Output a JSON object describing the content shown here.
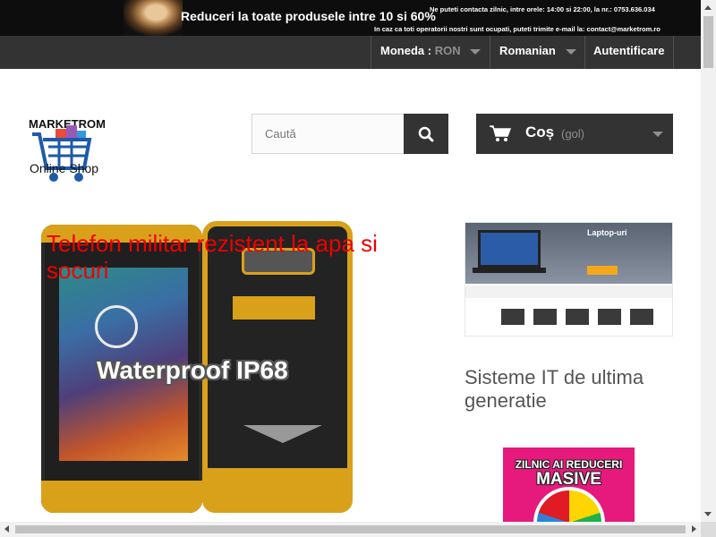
{
  "promo_banner": {
    "title": "Reduceri la toate produsele intre 10 si 60%",
    "contact": "Ne puteti contacta zilnic, intre orele: 14:00 si 22:00, la nr.: 0753.636.034",
    "fallback": "In caz ca toti operatorii nostri sunt ocupati, puteti trimite e-mail la: contact@marketrom.ro"
  },
  "nav": {
    "currency_label": "Moneda :",
    "currency_value": "RON",
    "language": "Romanian",
    "login": "Autentificare"
  },
  "header": {
    "logo_text": "MARKETROM",
    "logo_sub": "Online Shop",
    "search_placeholder": "Caută",
    "cart_label": "Coș",
    "cart_state": "(gol)"
  },
  "slider": {
    "title": "Telefon militar rezistent la apa si socuri",
    "image_text": "Waterproof IP68"
  },
  "sidebar": {
    "banner_title": "Laptop-uri",
    "heading": "Sisteme IT de ultima generatie",
    "promo_line1": "ZILNIC AI REDUCERI",
    "promo_line2": "MASIVE"
  },
  "colors": {
    "dark_bar": "#333333",
    "slide_title": "#ee0000",
    "promo_pink": "#e6197d"
  }
}
